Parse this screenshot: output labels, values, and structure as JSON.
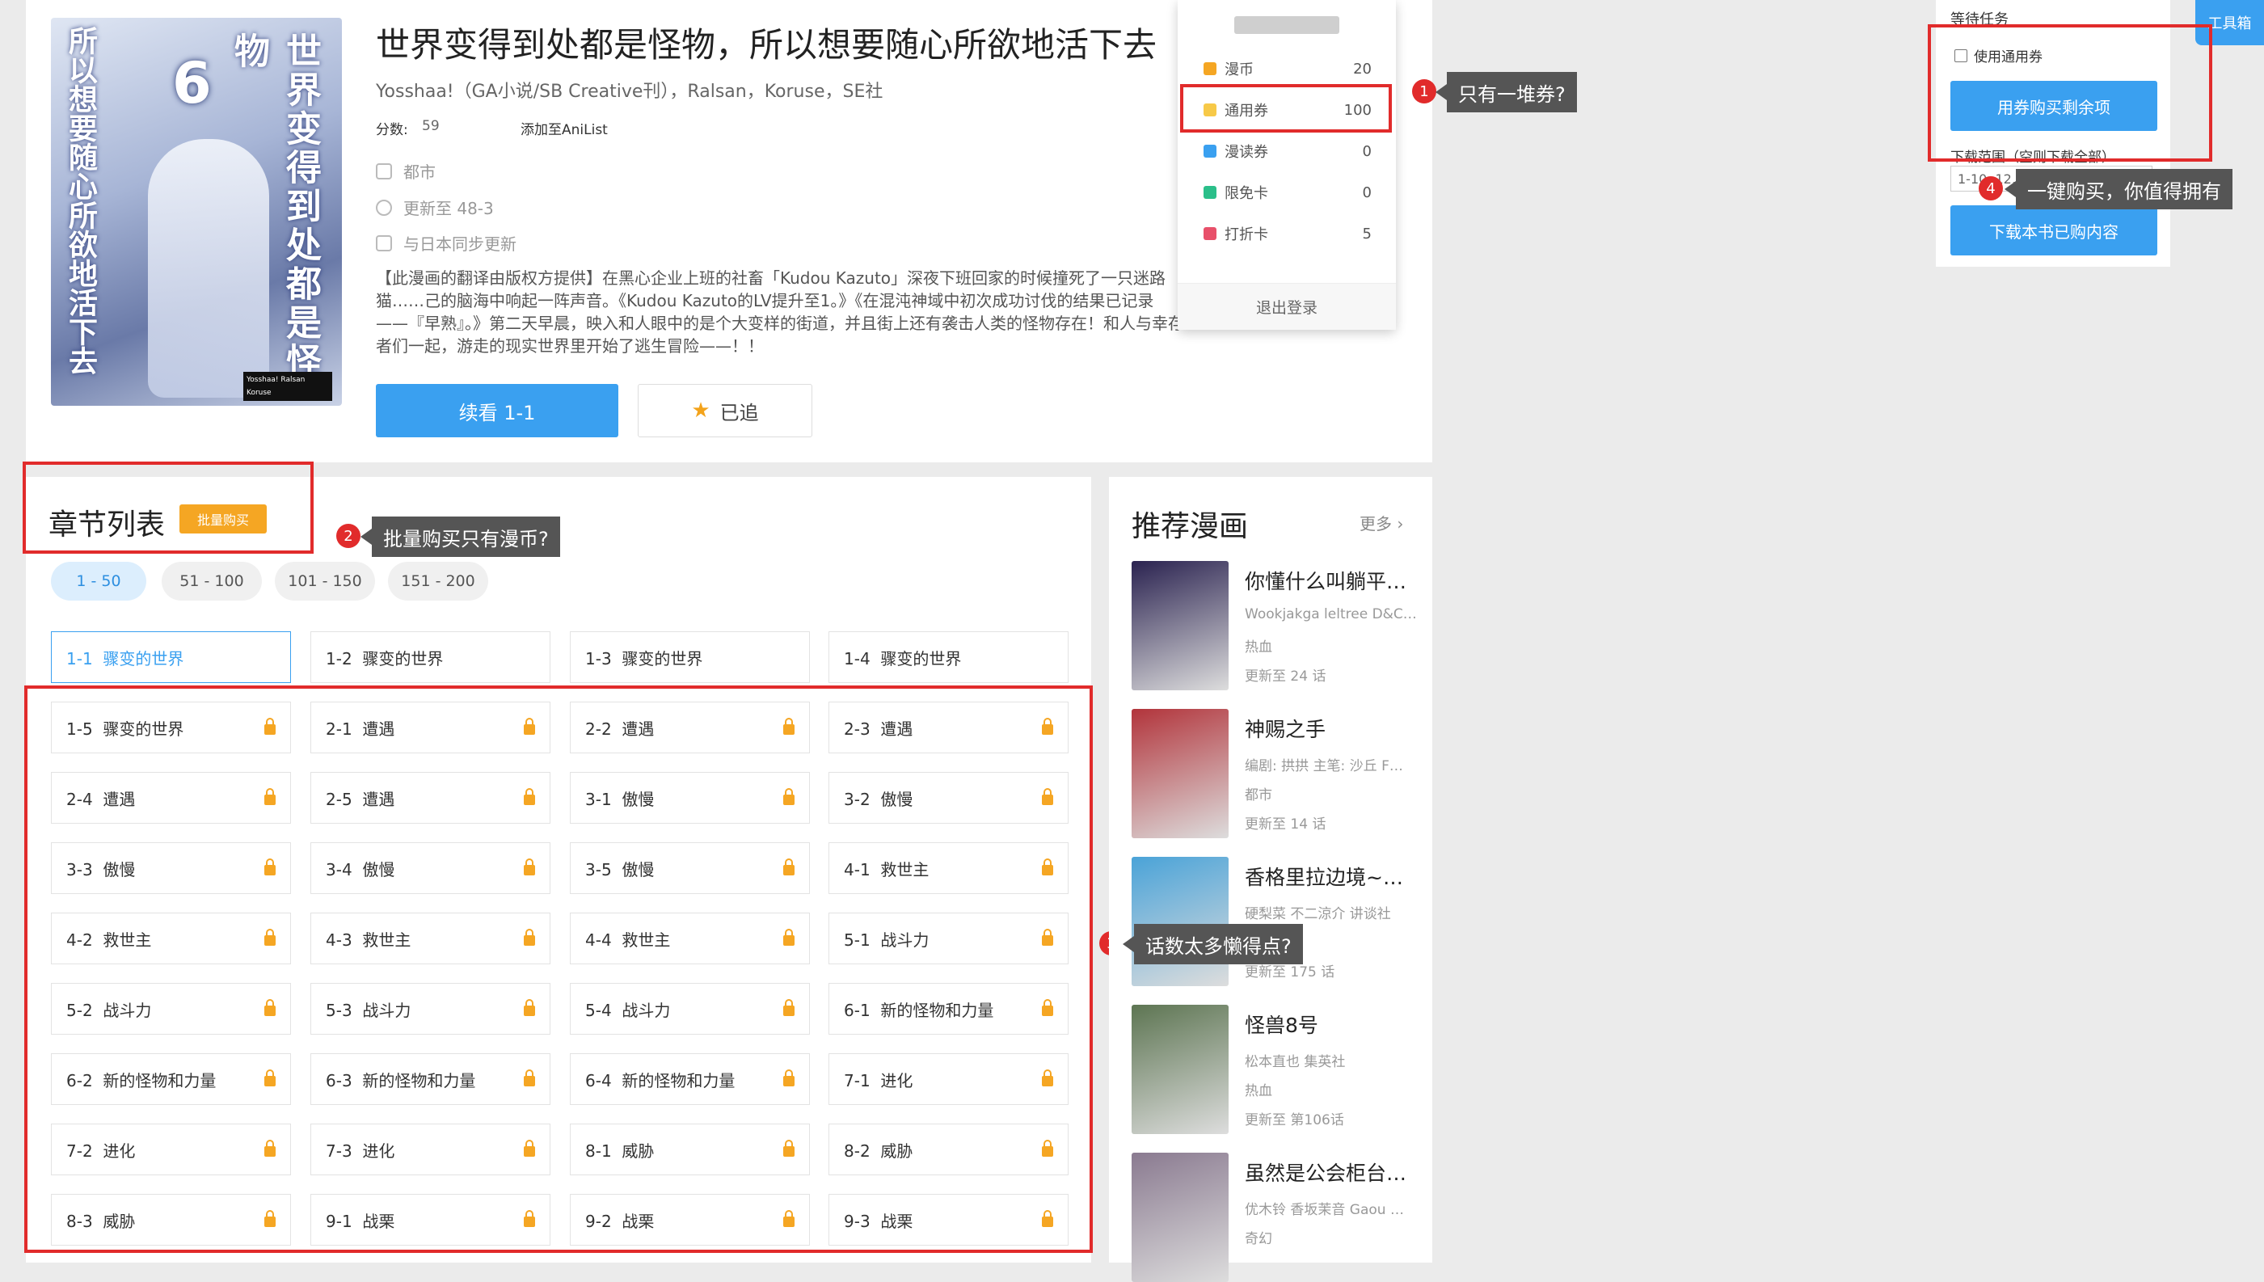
{
  "manga": {
    "cover_vertical_title": "世界变得到处都是怪物",
    "cover_vertical_title2": "所以想要随心所欲地活下去",
    "cover_volume": "6",
    "cover_credit": "Yosshaa! Ralsan Koruse",
    "title": "世界变得到处都是怪物，所以想要随心所欲地活下去",
    "authors": "Yosshaa!（GA小说/SB Creative刊），Ralsan，Koruse，SE社",
    "score_label": "分数:",
    "score_value": "59",
    "anilist_link": "添加至AniList",
    "genre": "都市",
    "updated": "更新至 48-3",
    "sync": "与日本同步更新",
    "description": "【此漫画的翻译由版权方提供】在黑心企业上班的社畜「Kudou Kazuto」深夜下班回家的时候撞死了一只迷路猫……己的脑海中响起一阵声音。《Kudou Kazuto的LV提升至1。》《在混沌神域中初次成功讨伐的结果已记录——『早熟』。》第二天早晨，映入和人眼中的是个大变样的街道，并且街上还有袭击人类的怪物存在！和人与幸存者们一起，游走的现实世界里开始了逃生冒险——！！",
    "read_button": "续看 1-1",
    "follow_button": "已追"
  },
  "account_dropdown": {
    "rows": [
      {
        "label": "漫币",
        "value": "20",
        "color": "#f5a623"
      },
      {
        "label": "通用券",
        "value": "100",
        "color": "#f7c948"
      },
      {
        "label": "漫读券",
        "value": "0",
        "color": "#3aa0f0"
      },
      {
        "label": "限免卡",
        "value": "0",
        "color": "#2bbf8a"
      },
      {
        "label": "打折卡",
        "value": "5",
        "color": "#e8506a"
      }
    ],
    "logout": "退出登录"
  },
  "annotations": [
    {
      "num": "1",
      "text": "只有一堆券?"
    },
    {
      "num": "2",
      "text": "批量购买只有漫币?"
    },
    {
      "num": "3",
      "text": "话数太多懒得点?"
    },
    {
      "num": "4",
      "text": "一键购买，你值得拥有"
    }
  ],
  "chapters": {
    "heading": "章节列表",
    "batch_buy": "批量购买",
    "ranges": [
      "1 - 50",
      "51 - 100",
      "101 - 150",
      "151 - 200"
    ],
    "items": [
      {
        "num": "1-1",
        "name": "骤变的世界",
        "locked": false
      },
      {
        "num": "1-2",
        "name": "骤变的世界",
        "locked": false
      },
      {
        "num": "1-3",
        "name": "骤变的世界",
        "locked": false
      },
      {
        "num": "1-4",
        "name": "骤变的世界",
        "locked": false
      },
      {
        "num": "1-5",
        "name": "骤变的世界",
        "locked": true
      },
      {
        "num": "2-1",
        "name": "遭遇",
        "locked": true
      },
      {
        "num": "2-2",
        "name": "遭遇",
        "locked": true
      },
      {
        "num": "2-3",
        "name": "遭遇",
        "locked": true
      },
      {
        "num": "2-4",
        "name": "遭遇",
        "locked": true
      },
      {
        "num": "2-5",
        "name": "遭遇",
        "locked": true
      },
      {
        "num": "3-1",
        "name": "傲慢",
        "locked": true
      },
      {
        "num": "3-2",
        "name": "傲慢",
        "locked": true
      },
      {
        "num": "3-3",
        "name": "傲慢",
        "locked": true
      },
      {
        "num": "3-4",
        "name": "傲慢",
        "locked": true
      },
      {
        "num": "3-5",
        "name": "傲慢",
        "locked": true
      },
      {
        "num": "4-1",
        "name": "救世主",
        "locked": true
      },
      {
        "num": "4-2",
        "name": "救世主",
        "locked": true
      },
      {
        "num": "4-3",
        "name": "救世主",
        "locked": true
      },
      {
        "num": "4-4",
        "name": "救世主",
        "locked": true
      },
      {
        "num": "5-1",
        "name": "战斗力",
        "locked": true
      },
      {
        "num": "5-2",
        "name": "战斗力",
        "locked": true
      },
      {
        "num": "5-3",
        "name": "战斗力",
        "locked": true
      },
      {
        "num": "5-4",
        "name": "战斗力",
        "locked": true
      },
      {
        "num": "6-1",
        "name": "新的怪物和力量",
        "locked": true
      },
      {
        "num": "6-2",
        "name": "新的怪物和力量",
        "locked": true
      },
      {
        "num": "6-3",
        "name": "新的怪物和力量",
        "locked": true
      },
      {
        "num": "6-4",
        "name": "新的怪物和力量",
        "locked": true
      },
      {
        "num": "7-1",
        "name": "进化",
        "locked": true
      },
      {
        "num": "7-2",
        "name": "进化",
        "locked": true
      },
      {
        "num": "7-3",
        "name": "进化",
        "locked": true
      },
      {
        "num": "8-1",
        "name": "威胁",
        "locked": true
      },
      {
        "num": "8-2",
        "name": "威胁",
        "locked": true
      },
      {
        "num": "8-3",
        "name": "威胁",
        "locked": true
      },
      {
        "num": "9-1",
        "name": "战栗",
        "locked": true
      },
      {
        "num": "9-2",
        "name": "战栗",
        "locked": true
      },
      {
        "num": "9-3",
        "name": "战栗",
        "locked": true
      }
    ]
  },
  "recommend": {
    "heading": "推荐漫画",
    "more": "更多",
    "items": [
      {
        "name": "你懂什么叫躺平…",
        "sub": "Wookjakga leltree D&C …",
        "tag": "热血",
        "updated": "更新至 24 话",
        "color": "#2a2250"
      },
      {
        "name": "神赐之手",
        "sub": "编剧: 拱拱 主笔: 沙丘 F…",
        "tag": "都市",
        "updated": "更新至 14 话",
        "color": "#b2343b"
      },
      {
        "name": "香格里拉边境~粪…",
        "sub": "硬梨菜 不二涼介 讲谈社",
        "tag": "",
        "updated": "更新至 175 话",
        "color": "#4aa3d8"
      },
      {
        "name": "怪兽8号",
        "sub": "松本直也 集英社",
        "tag": "热血",
        "updated": "更新至 第106话",
        "color": "#5d7552"
      },
      {
        "name": "虽然是公会柜台…",
        "sub": "优木铃 香坂茉音 Gaou …",
        "tag": "奇幻",
        "updated": "",
        "color": "#8a7a90"
      }
    ]
  },
  "tool_panel": {
    "heading": "等待任务",
    "use_ticket": "使用通用券",
    "buy_button": "用券购买剩余项",
    "range_label": "下载范围（空则下载全部）",
    "range_value": "1-10, 12, 15-20",
    "download_button": "下载本书已购内容",
    "toolbox": "工具箱"
  }
}
